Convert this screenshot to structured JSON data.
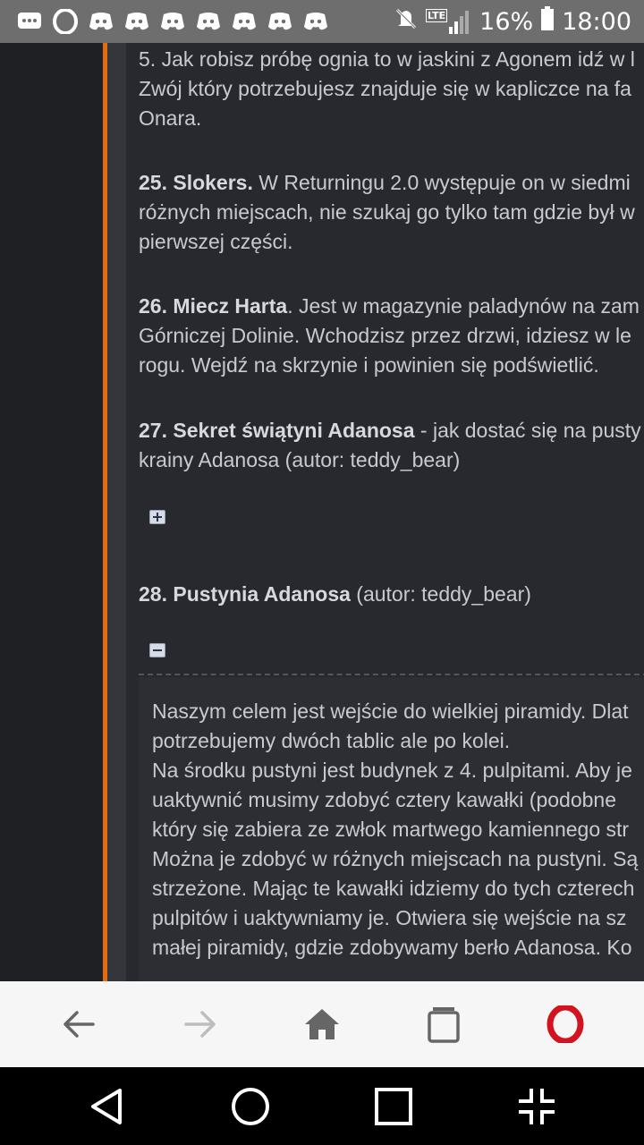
{
  "status_bar": {
    "network": "LTE",
    "battery_percent": "16%",
    "time": "18:00",
    "notification_icons": [
      "chat-bubble-icon",
      "opera-icon",
      "discord-icon",
      "discord-icon",
      "discord-icon",
      "discord-icon",
      "discord-icon",
      "discord-icon",
      "discord-icon"
    ]
  },
  "article": {
    "p5": {
      "line1": "5. Jak robisz próbę ognia to w jaskini z Agonem idź w l",
      "line2": "Zwój który potrzebujesz znajduje się w kapliczce na fa",
      "line3": "Onara."
    },
    "p25": {
      "title": "25. Slokers.",
      "line1_rest": " W Returningu 2.0 występuje on w siedmi",
      "line2": "różnych miejscach, nie szukaj go tylko tam gdzie był w",
      "line3": "pierwszej części."
    },
    "p26": {
      "title": "26. Miecz Harta",
      "line1_rest": ". Jest w magazynie paladynów na zam",
      "line2": "Górniczej Dolinie. Wchodzisz przez drzwi, idziesz w le",
      "line3": "rogu. Wejdź na skrzynie i powinien się podświetlić."
    },
    "p27": {
      "title": "27. Sekret świątyni Adanosa",
      "line1_rest": " - jak dostać się na pusty",
      "line2": "krainy Adanosa (autor: teddy_bear)"
    },
    "p28": {
      "title": "28. Pustynia Adanosa",
      "line1_rest": " (autor: teddy_bear)"
    },
    "spoiler_lines": [
      "Naszym celem jest wejście do wielkiej piramidy. Dlat",
      "potrzebujemy dwóch tablic ale po kolei.",
      "Na środku pustyni jest budynek z 4. pulpitami. Aby je",
      "uaktywnić musimy zdobyć cztery kawałki (podobne",
      "który się zabiera ze zwłok martwego kamiennego str",
      "Można je zdobyć w różnych miejscach na pustyni. Są",
      "strzeżone. Mając te kawałki idziemy do tych czterech",
      "pulpitów i uaktywniamy je. Otwiera się wejście na sz",
      "małej piramidy, gdzie zdobywamy berło Adanosa. Ko"
    ]
  },
  "colors": {
    "accent_orange": "#e46b10",
    "page_bg": "#28292e",
    "opera_red": "#d1141f"
  }
}
